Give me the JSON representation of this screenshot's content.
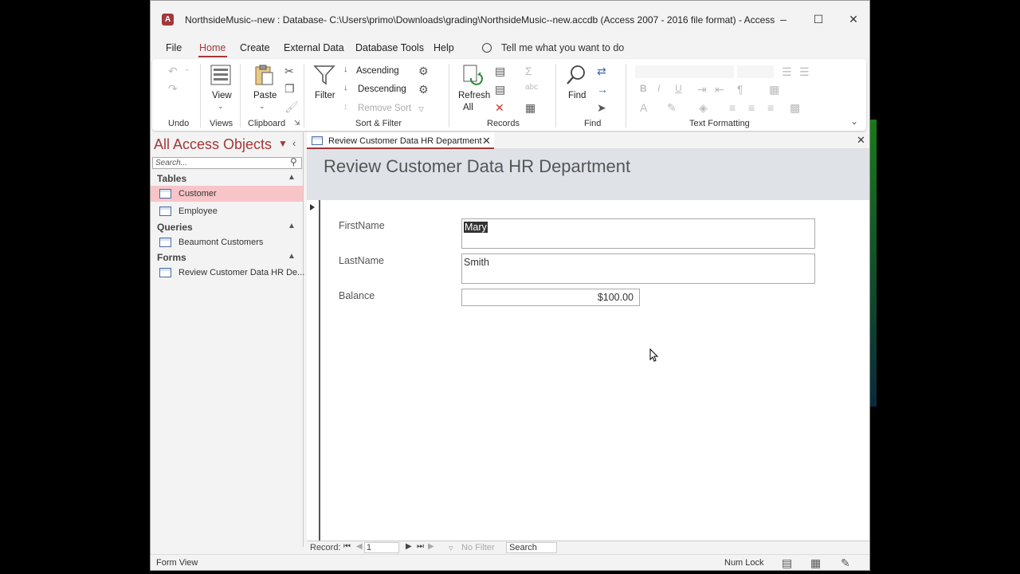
{
  "window": {
    "title": "NorthsideMusic--new : Database- C:\\Users\\primo\\Downloads\\grading\\NorthsideMusic--new.accdb (Access 2007 - 2016 file format)  -  Access",
    "logo_letter": "A"
  },
  "menu": {
    "items": [
      "File",
      "Home",
      "Create",
      "External Data",
      "Database Tools",
      "Help"
    ],
    "active": "Home",
    "tell_me": "Tell me what you want to do"
  },
  "ribbon": {
    "groups": {
      "undo": "Undo",
      "views": "Views",
      "clipboard": "Clipboard",
      "sort_filter": "Sort & Filter",
      "records": "Records",
      "find": "Find",
      "text_formatting": "Text Formatting"
    },
    "buttons": {
      "view": "View",
      "paste": "Paste",
      "filter": "Filter",
      "ascending": "Ascending",
      "descending": "Descending",
      "remove_sort": "Remove Sort",
      "refresh": "Refresh",
      "refresh_all": "All",
      "find": "Find"
    }
  },
  "nav": {
    "title": "All Access Objects",
    "search_placeholder": "Search...",
    "sections": [
      {
        "name": "Tables",
        "items": [
          "Customer",
          "Employee"
        ],
        "selected": "Customer"
      },
      {
        "name": "Queries",
        "items": [
          "Beaumont Customers"
        ]
      },
      {
        "name": "Forms",
        "items": [
          "Review Customer Data HR De..."
        ]
      }
    ]
  },
  "document": {
    "tab_label": "Review Customer Data HR Department",
    "form_title": "Review Customer Data HR Department",
    "fields": [
      {
        "label": "FirstName",
        "value": "Mary"
      },
      {
        "label": "LastName",
        "value": "Smith"
      },
      {
        "label": "Balance",
        "value": "$100.00"
      }
    ]
  },
  "record_nav": {
    "label": "Record:",
    "current": "1",
    "filter": "No Filter",
    "search": "Search"
  },
  "status": {
    "view": "Form View",
    "num_lock": "Num Lock"
  },
  "colors": {
    "accent": "#a4373a",
    "selected_bg": "#f7c5c8"
  }
}
